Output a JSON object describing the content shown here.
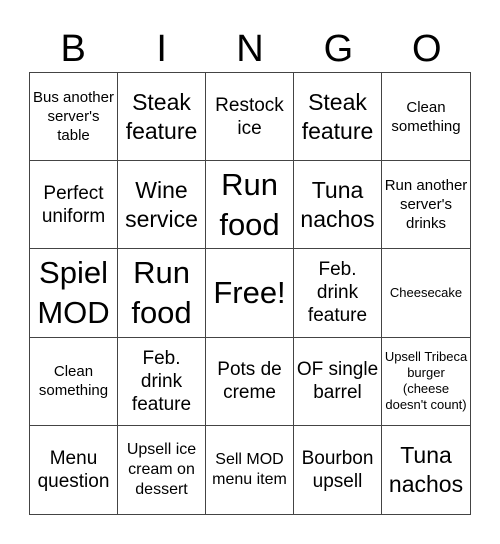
{
  "header": {
    "letters": [
      "B",
      "I",
      "N",
      "G",
      "O"
    ]
  },
  "grid": {
    "rows": [
      [
        {
          "text": "Bus another server's table",
          "size": "s-xs"
        },
        {
          "text": "Steak feature",
          "size": "s-l"
        },
        {
          "text": "Restock ice",
          "size": "s-m"
        },
        {
          "text": "Steak feature",
          "size": "s-l"
        },
        {
          "text": "Clean something",
          "size": "s-xs"
        }
      ],
      [
        {
          "text": "Perfect uniform",
          "size": "s-m"
        },
        {
          "text": "Wine service",
          "size": "s-l"
        },
        {
          "text": "Run food",
          "size": "s-xl"
        },
        {
          "text": "Tuna nachos",
          "size": "s-l"
        },
        {
          "text": "Run another server's drinks",
          "size": "s-xs"
        }
      ],
      [
        {
          "text": "Spiel MOD",
          "size": "s-xl"
        },
        {
          "text": "Run food",
          "size": "s-xl"
        },
        {
          "text": "Free!",
          "size": "s-xl"
        },
        {
          "text": "Feb. drink feature",
          "size": "s-m"
        },
        {
          "text": "Cheesecake",
          "size": "s-xxs"
        }
      ],
      [
        {
          "text": "Clean something",
          "size": "s-xs"
        },
        {
          "text": "Feb. drink feature",
          "size": "s-m"
        },
        {
          "text": "Pots de creme",
          "size": "s-m"
        },
        {
          "text": "OF single barrel",
          "size": "s-m"
        },
        {
          "text": "Upsell Tribeca burger (cheese doesn't count)",
          "size": "s-xxs"
        }
      ],
      [
        {
          "text": "Menu question",
          "size": "s-m"
        },
        {
          "text": "Upsell ice cream on dessert",
          "size": "s-s"
        },
        {
          "text": "Sell MOD menu item",
          "size": "s-s"
        },
        {
          "text": "Bourbon upsell",
          "size": "s-m"
        },
        {
          "text": "Tuna nachos",
          "size": "s-l"
        }
      ]
    ]
  }
}
